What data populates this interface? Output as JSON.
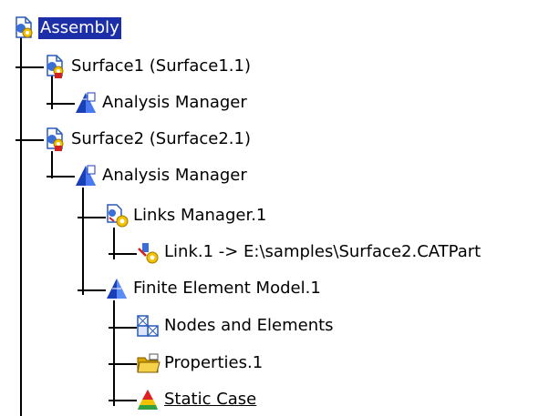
{
  "tree": {
    "root": {
      "label": "Assembly",
      "icon": "assembly-icon"
    },
    "surface1": {
      "label": "Surface1 (Surface1.1)",
      "icon": "part-surface-icon",
      "children": {
        "analysis_manager": {
          "label": "Analysis Manager",
          "icon": "analysis-manager-icon"
        }
      }
    },
    "surface2": {
      "label": "Surface2 (Surface2.1)",
      "icon": "part-surface-icon",
      "children": {
        "analysis_manager": {
          "label": "Analysis Manager",
          "icon": "analysis-manager-icon",
          "children": {
            "links_manager": {
              "label": "Links Manager.1",
              "icon": "links-manager-icon",
              "children": {
                "link1": {
                  "label": "Link.1 -> E:\\samples\\Surface2.CATPart",
                  "icon": "link-icon"
                }
              }
            },
            "fem": {
              "label": "Finite Element Model.1",
              "icon": "finite-element-model-icon",
              "children": {
                "nodes": {
                  "label": "Nodes and Elements",
                  "icon": "nodes-elements-icon"
                },
                "properties": {
                  "label": "Properties.1",
                  "icon": "folder-icon"
                },
                "static_case": {
                  "label": "Static Case",
                  "icon": "static-case-icon"
                }
              }
            }
          }
        }
      }
    }
  }
}
